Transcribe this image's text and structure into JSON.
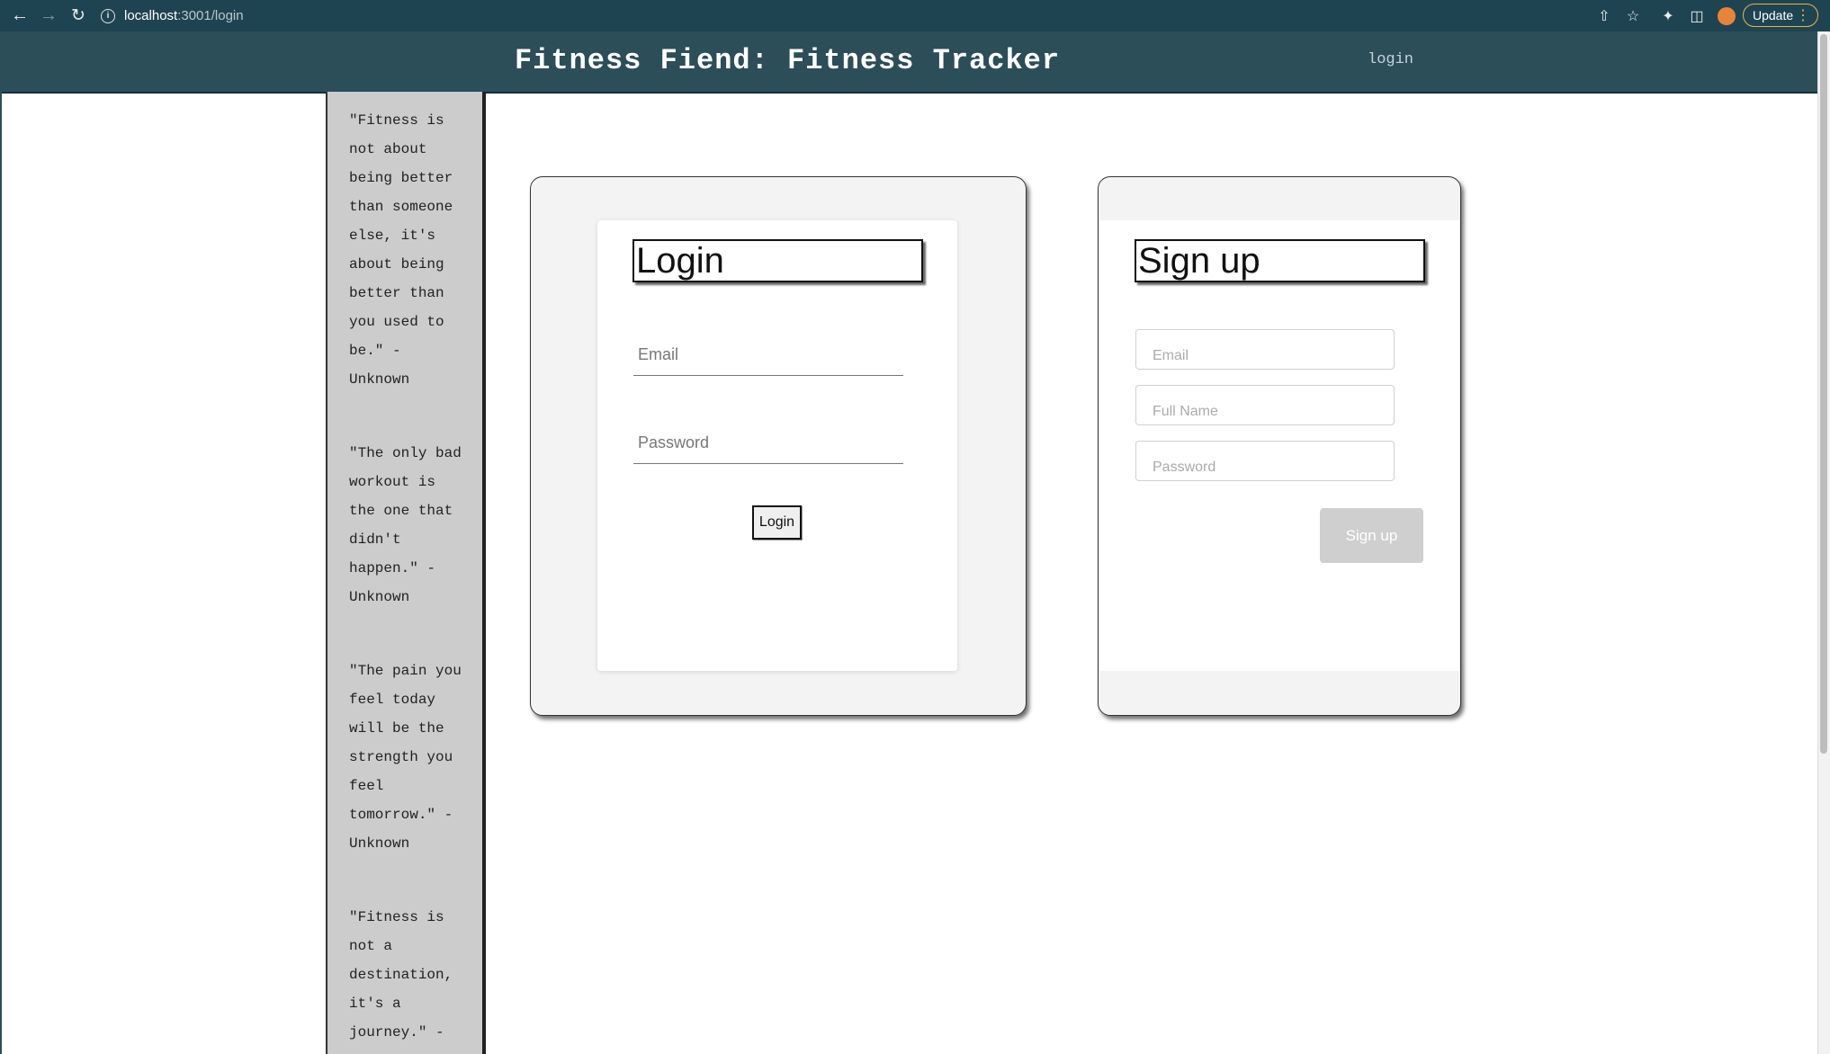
{
  "browser": {
    "url_host": "localhost",
    "url_path": ":3001/login",
    "update_label": "Update"
  },
  "header": {
    "title": "Fitness Fiend: Fitness Tracker",
    "login_link": "login"
  },
  "quotes": [
    "\"Fitness is not about being better than someone else, it's about being better than you used to be.\" - Unknown",
    "\"The only bad workout is the one that didn't happen.\" - Unknown",
    "\"The pain you feel today will be the strength you feel tomorrow.\" - Unknown",
    "\"Fitness is not a destination, it's a journey.\" -"
  ],
  "login": {
    "title": "Login",
    "email_placeholder": "Email",
    "password_placeholder": "Password",
    "button_label": "Login"
  },
  "signup": {
    "title": "Sign up",
    "email_placeholder": "Email",
    "name_placeholder": "Full Name",
    "password_placeholder": "Password",
    "button_label": "Sign up"
  }
}
